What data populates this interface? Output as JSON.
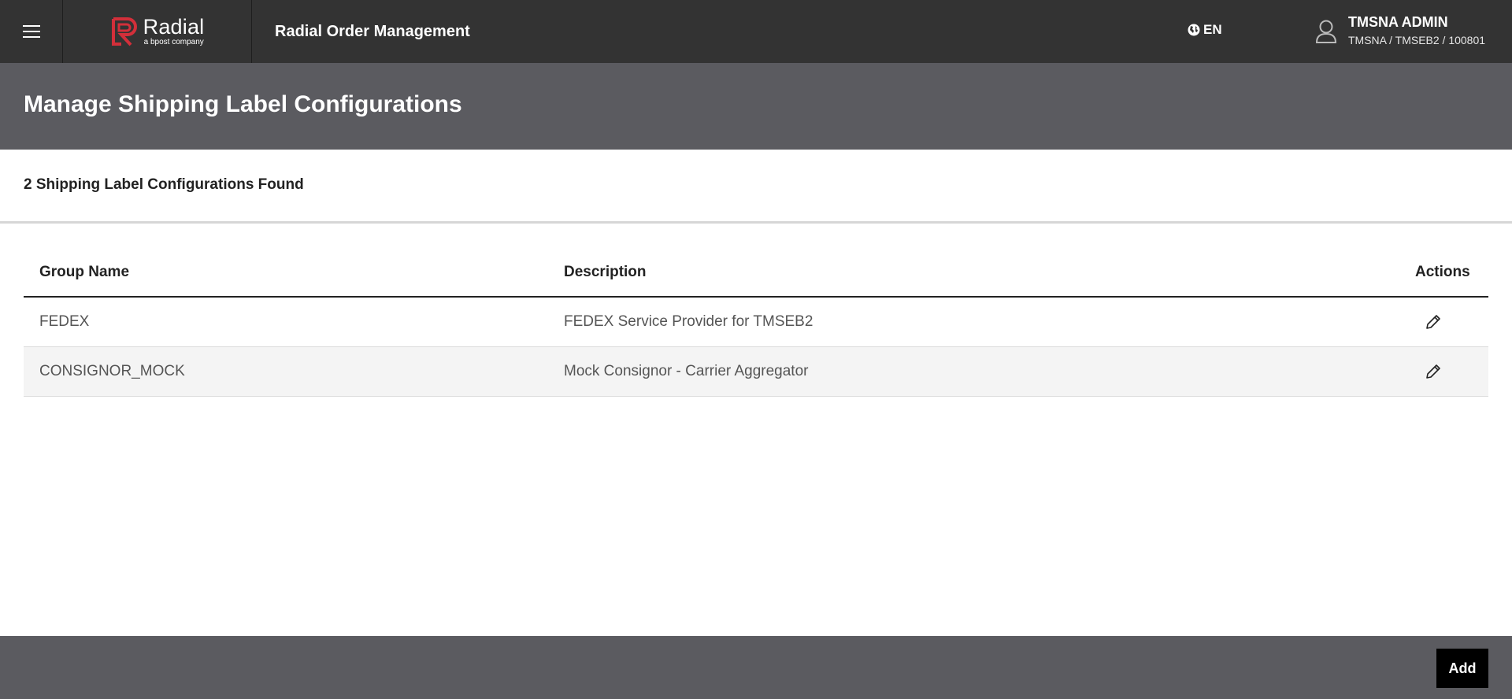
{
  "header": {
    "menu_icon": "hamburger-icon",
    "logo_name": "Radial",
    "logo_tagline": "a bpost company",
    "app_title": "Radial Order Management",
    "language": "EN",
    "user_name": "TMSNA ADMIN",
    "user_context": "TMSNA / TMSEB2 / 100801"
  },
  "page": {
    "title": "Manage Shipping Label Configurations",
    "count_text": "2 Shipping Label Configurations Found"
  },
  "table": {
    "columns": [
      "Group Name",
      "Description",
      "Actions"
    ],
    "rows": [
      {
        "group_name": "FEDEX",
        "description": "FEDEX Service Provider for TMSEB2",
        "action_icon": "pencil-icon"
      },
      {
        "group_name": "CONSIGNOR_MOCK",
        "description": "Mock Consignor - Carrier Aggregator",
        "action_icon": "pencil-icon"
      }
    ]
  },
  "footer": {
    "add_label": "Add"
  },
  "colors": {
    "topbar": "#333333",
    "page_header": "#5b5b60",
    "brand_red": "#d32f3a",
    "row_alt": "#f4f4f4"
  }
}
